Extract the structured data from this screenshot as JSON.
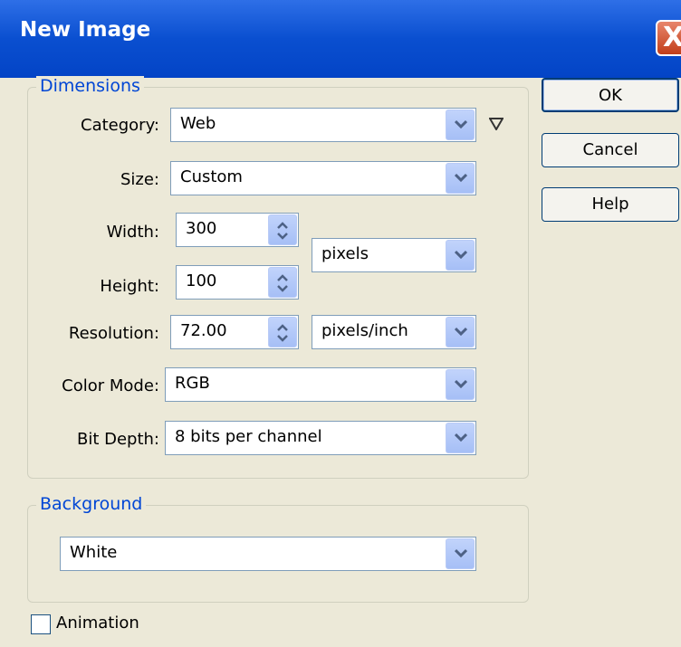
{
  "window": {
    "title": "New Image",
    "close_label": "X"
  },
  "dimensions": {
    "legend": "Dimensions",
    "category": {
      "label": "Category:",
      "value": "Web"
    },
    "size": {
      "label": "Size:",
      "value": "Custom"
    },
    "width": {
      "label": "Width:",
      "value": "300"
    },
    "height": {
      "label": "Height:",
      "value": "100"
    },
    "size_unit": {
      "value": "pixels"
    },
    "resolution": {
      "label": "Resolution:",
      "value": "72.00",
      "unit": "pixels/inch"
    },
    "color_mode": {
      "label": "Color Mode:",
      "value": "RGB"
    },
    "bit_depth": {
      "label": "Bit Depth:",
      "value": "8 bits per channel"
    }
  },
  "background": {
    "legend": "Background",
    "value": "White"
  },
  "animation": {
    "label": "Animation",
    "checked": false
  },
  "buttons": {
    "ok": "OK",
    "cancel": "Cancel",
    "help": "Help"
  },
  "icons": {
    "dropdown": "chevron-down-icon",
    "spinner": "up-down-spinner-icon",
    "category_menu": "triangle-down-icon",
    "close": "close-icon"
  },
  "colors": {
    "title_bar": "#0A4FD0",
    "dialog_bg": "#ECE9D8",
    "legend_text": "#0046D5",
    "close_button": "#C23E19"
  }
}
